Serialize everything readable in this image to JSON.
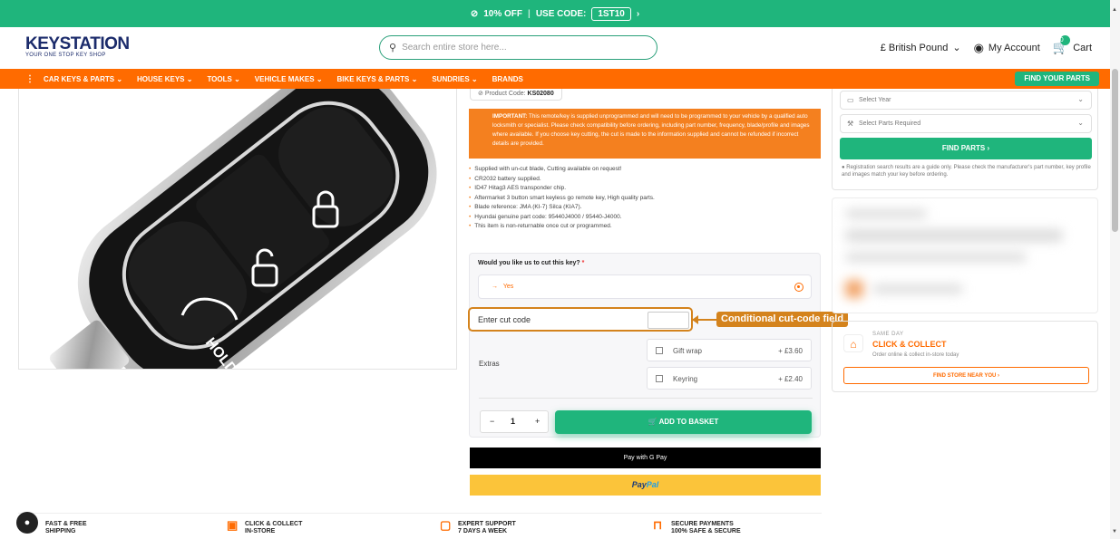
{
  "promo": {
    "text": "10% OFF",
    "sep": "|",
    "use": "USE CODE:",
    "code": "1ST10",
    "arrow": "›"
  },
  "header": {
    "logo_main": "KEYSTATION",
    "logo_sub": "YOUR ONE STOP KEY SHOP",
    "search_placeholder": "Search entire store here...",
    "currency": "£ British Pound",
    "account": "My Account",
    "cart": "Cart",
    "cart_count": "0"
  },
  "nav": {
    "items": [
      "CAR KEYS & PARTS",
      "HOUSE KEYS",
      "TOOLS",
      "VEHICLE MAKES",
      "BIKE KEYS & PARTS",
      "SUNDRIES",
      "BRANDS"
    ],
    "find": "FIND YOUR PARTS"
  },
  "product": {
    "code_label": "Product Code:",
    "code": "KS02080",
    "important_label": "IMPORTANT:",
    "important_text": "This remote/key is supplied unprogrammed and will need to be programmed to your vehicle by a qualified auto locksmith or specialist. Please check compatibility before ordering, including part number, frequency, blade/profile and images where available. If you choose key cutting, the cut is made to the information supplied and cannot be refunded if incorrect details are provided.",
    "bullets": [
      "Supplied with un-cut blade, Cutting available on request!",
      "CR2032 battery supplied.",
      "ID47 Hitag3 AES transponder chip.",
      "Aftermarket 3 button smart keyless go remote key, High quality parts.",
      "Blade reference: JMA (KI-7) Silca (KIA7).",
      "Hyundai genuine part code: 95440J4000 / 95440-J4000.",
      "This item is non-returnable once cut or programmed."
    ],
    "key_button_hold": "HOLD"
  },
  "options": {
    "question": "Would you like us to cut this key?",
    "required": "*",
    "yes": "Yes",
    "yes_arrow": "→",
    "cut_label": "Enter cut code",
    "annotation": "Conditional cut-code field",
    "extras_label": "Extras",
    "extras": [
      {
        "name": "Gift wrap",
        "price": "+ £3.60"
      },
      {
        "name": "Keyring",
        "price": "+ £2.40"
      }
    ],
    "qty": "1",
    "minus": "−",
    "plus": "+",
    "add": "ADD TO BASKET",
    "gpay": "Pay with G Pay",
    "paypal_a": "Pay",
    "paypal_b": "Pal"
  },
  "finder": {
    "year": "Select Year",
    "parts": "Select Parts Required",
    "find": "FIND PARTS  ›",
    "note": "Registration search results are a guide only. Please check the manufacturer's part number, key profile and images match your key before ordering."
  },
  "collect": {
    "same_day": "SAME DAY",
    "title": "CLICK & COLLECT",
    "sub": "Order online & collect in-store today",
    "find": "FIND STORE NEAR YOU  ›"
  },
  "features": [
    {
      "l1": "FAST & FREE",
      "l2": "SHIPPING"
    },
    {
      "l1": "CLICK & COLLECT",
      "l2": "IN-STORE"
    },
    {
      "l1": "EXPERT SUPPORT",
      "l2": "7 DAYS A WEEK"
    },
    {
      "l1": "SECURE PAYMENTS",
      "l2": "100% SAFE & SECURE"
    }
  ],
  "colors": {
    "green": "#1fb57c",
    "orange": "#ff6b00",
    "annotation": "#d4831d",
    "navy": "#1b2b6b"
  }
}
